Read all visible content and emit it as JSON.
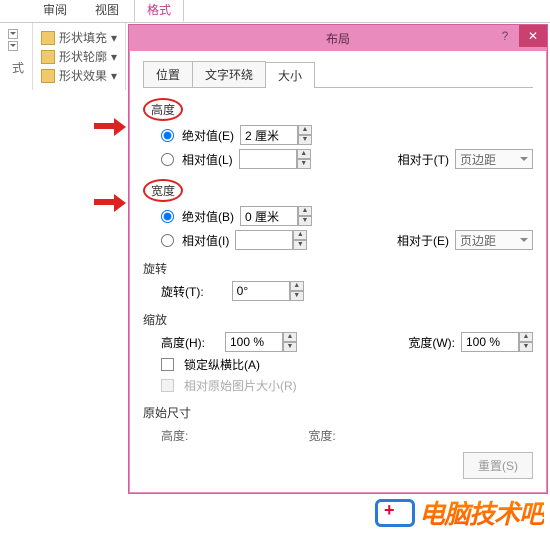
{
  "ribbon": {
    "tabs": [
      "审阅",
      "视图",
      "格式"
    ],
    "active_tab": "格式",
    "shape_fill": "形状填充",
    "shape_outline": "形状轮廓",
    "shape_effects": "形状效果",
    "style_group": "式"
  },
  "dialog": {
    "title": "布局",
    "help": "?",
    "close": "✕",
    "tabs": {
      "position": "位置",
      "wrap": "文字环绕",
      "size": "大小"
    },
    "height": {
      "label": "高度",
      "abs_label": "绝对值(E)",
      "abs_value": "2 厘米",
      "rel_label": "相对值(L)",
      "rel_value": "",
      "rel_to_label": "相对于(T)",
      "rel_to_value": "页边距"
    },
    "width": {
      "label": "宽度",
      "abs_label": "绝对值(B)",
      "abs_value": "0 厘米",
      "rel_label": "相对值(I)",
      "rel_value": "",
      "rel_to_label": "相对于(E)",
      "rel_to_value": "页边距"
    },
    "rotate": {
      "label": "旋转",
      "field_label": "旋转(T):",
      "value": "0°"
    },
    "scale": {
      "label": "缩放",
      "h_label": "高度(H):",
      "h_value": "100 %",
      "w_label": "宽度(W):",
      "w_value": "100 %",
      "lock": "锁定纵横比(A)",
      "orig": "相对原始图片大小(R)"
    },
    "original": {
      "label": "原始尺寸",
      "h": "高度:",
      "w": "宽度:"
    },
    "reset": "重置(S)"
  },
  "watermark": "电脑技术吧"
}
